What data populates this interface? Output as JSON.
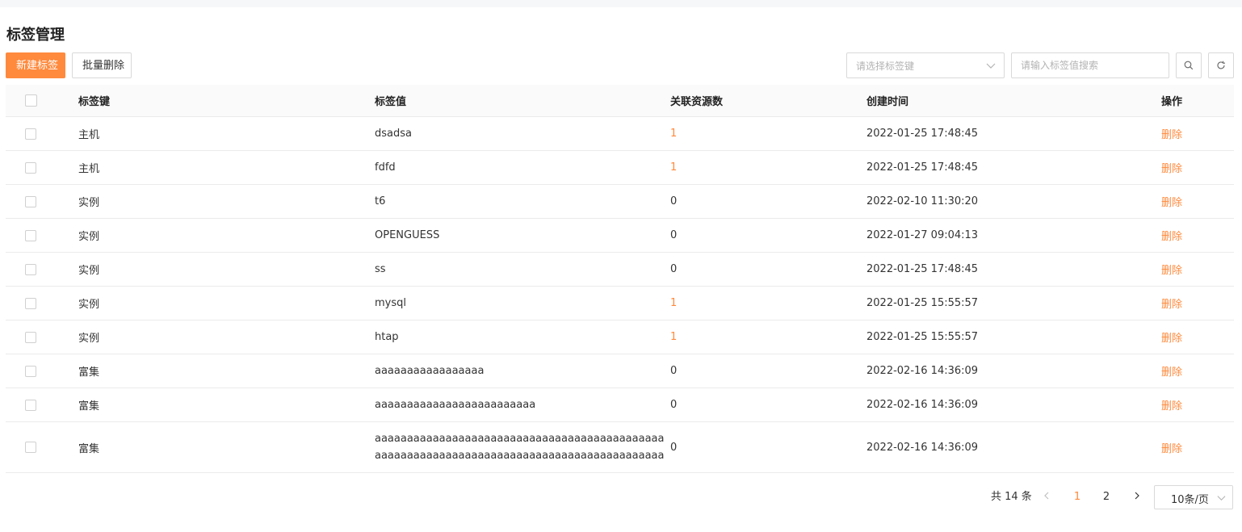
{
  "page": {
    "title": "标签管理"
  },
  "toolbar": {
    "new_label": "新建标签",
    "batch_delete_label": "批量删除",
    "key_select_placeholder": "请选择标签键",
    "search_placeholder": "请输入标签值搜索"
  },
  "icons": {
    "select_chevron": "chevron-down-icon",
    "search": "search-icon",
    "refresh": "refresh-icon",
    "prev": "chevron-left-icon",
    "next": "chevron-right-icon"
  },
  "colors": {
    "accent": "#ff8a3d",
    "border": "#d9d9d9",
    "header_bg": "#fafafa"
  },
  "table": {
    "columns": {
      "key": "标签键",
      "value": "标签值",
      "count": "关联资源数",
      "created": "创建时间",
      "op": "操作"
    },
    "rows": [
      {
        "key": "主机",
        "value": "dsadsa",
        "count": "1",
        "created": "2022-01-25 17:48:45",
        "op": "删除"
      },
      {
        "key": "主机",
        "value": "fdfd",
        "count": "1",
        "created": "2022-01-25 17:48:45",
        "op": "删除"
      },
      {
        "key": "实例",
        "value": "t6",
        "count": "0",
        "created": "2022-02-10 11:30:20",
        "op": "删除"
      },
      {
        "key": "实例",
        "value": "OPENGUESS",
        "count": "0",
        "created": "2022-01-27 09:04:13",
        "op": "删除"
      },
      {
        "key": "实例",
        "value": "ss",
        "count": "0",
        "created": "2022-01-25 17:48:45",
        "op": "删除"
      },
      {
        "key": "实例",
        "value": "mysql",
        "count": "1",
        "created": "2022-01-25 15:55:57",
        "op": "删除"
      },
      {
        "key": "实例",
        "value": "htap",
        "count": "1",
        "created": "2022-01-25 15:55:57",
        "op": "删除"
      },
      {
        "key": "富集",
        "value": "aaaaaaaaaaaaaaaaa",
        "count": "0",
        "created": "2022-02-16 14:36:09",
        "op": "删除"
      },
      {
        "key": "富集",
        "value": "aaaaaaaaaaaaaaaaaaaaaaaaa",
        "count": "0",
        "created": "2022-02-16 14:36:09",
        "op": "删除"
      },
      {
        "key": "富集",
        "value": "aaaaaaaaaaaaaaaaaaaaaaaaaaaaaaaaaaaaaaaaaaaaaaaaaaaaaaaaaaaaaaaaaaaaaaaaaaaaaaaaaaaaaaaaaa",
        "count": "0",
        "created": "2022-02-16 14:36:09",
        "op": "删除"
      }
    ]
  },
  "pagination": {
    "total": "共 14 条",
    "pages": [
      "1",
      "2"
    ],
    "current": "1",
    "page_size": "10条/页"
  }
}
